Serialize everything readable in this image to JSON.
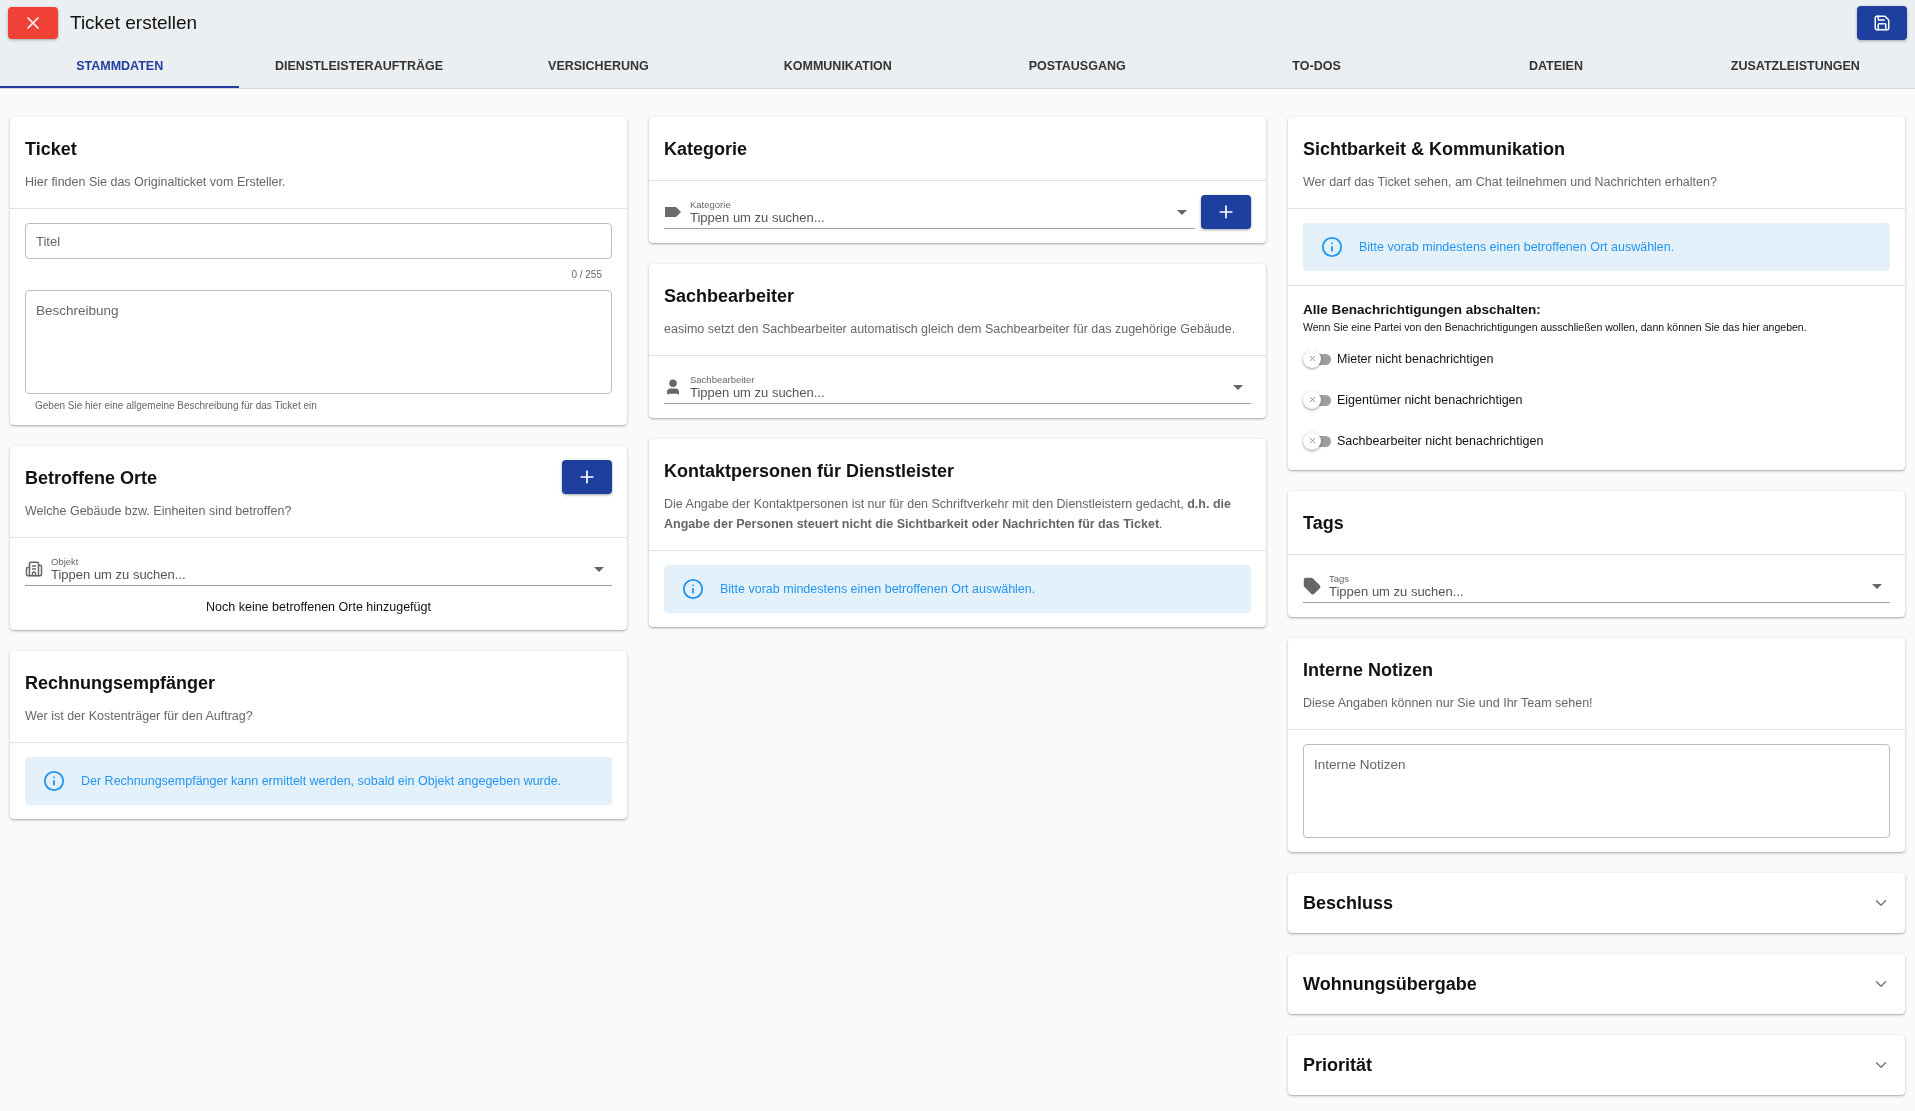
{
  "header": {
    "title": "Ticket erstellen"
  },
  "tabs": [
    {
      "label": "STAMMDATEN",
      "selected": true
    },
    {
      "label": "DIENSTLEISTERAUFTRÄGE",
      "selected": false
    },
    {
      "label": "VERSICHERUNG",
      "selected": false
    },
    {
      "label": "KOMMUNIKATION",
      "selected": false
    },
    {
      "label": "POSTAUSGANG",
      "selected": false
    },
    {
      "label": "TO-DOS",
      "selected": false
    },
    {
      "label": "DATEIEN",
      "selected": false
    },
    {
      "label": "ZUSATZLEISTUNGEN",
      "selected": false
    }
  ],
  "columns": [
    {
      "cards": [
        {
          "kind": "form",
          "title": "Ticket",
          "subtitle": "Hier finden Sie das Originalticket vom Ersteller.",
          "sections": [
            [
              {
                "kind": "text_field",
                "placeholder": "Titel",
                "counter": "0 / 255"
              },
              {
                "kind": "textarea",
                "placeholder": "Beschreibung",
                "helper": "Geben Sie hier eine allgemeine Beschreibung für das Ticket ein"
              }
            ]
          ]
        },
        {
          "kind": "form",
          "title": "Betroffene Orte",
          "subtitle": "Welche Gebäude bzw. Einheiten sind betroffen?",
          "add_button": true,
          "sections": [
            [
              {
                "kind": "select",
                "label": "Objekt",
                "placeholder": "Tippen um zu suchen..."
              },
              {
                "kind": "note",
                "text": "Noch keine betroffenen Orte hinzugefügt"
              }
            ]
          ]
        },
        {
          "kind": "form",
          "title": "Rechnungsempfänger",
          "subtitle": "Wer ist der Kostenträger für den Auftrag?",
          "sections": [
            [
              {
                "kind": "info",
                "text": "Der Rechnungsempfänger kann ermittelt werden, sobald ein Objekt angegeben wurde."
              }
            ]
          ]
        }
      ]
    },
    {
      "cards": [
        {
          "kind": "form",
          "title": "Kategorie",
          "sections": [
            [
              {
                "kind": "select",
                "label": "Kategorie",
                "placeholder": "Tippen um zu suchen...",
                "add_button": true
              }
            ]
          ]
        },
        {
          "kind": "form",
          "title": "Sachbearbeiter",
          "subtitle": "easimo setzt den Sachbearbeiter automatisch gleich dem Sachbearbeiter für das zugehörige Gebäude.",
          "sections": [
            [
              {
                "kind": "select",
                "label": "Sachbearbeiter",
                "placeholder": "Tippen um zu suchen..."
              }
            ]
          ]
        },
        {
          "kind": "form",
          "title": "Kontaktpersonen für Dienstleister",
          "subtitle": "Die Angabe der Kontaktpersonen ist nur für den Schriftverkehr mit den Dienstleistern gedacht, **d.h. die Angabe der Personen steuert nicht die Sichtbarkeit oder Nachrichten für das Ticket**.",
          "sections": [
            [
              {
                "kind": "info",
                "text": "Bitte vorab mindestens einen betroffenen Ort auswählen."
              }
            ]
          ]
        }
      ]
    },
    {
      "cards": [
        {
          "kind": "form",
          "title": "Sichtbarkeit & Kommunikation",
          "subtitle": "Wer darf das Ticket sehen, am Chat teilnehmen und Nachrichten erhalten?",
          "sections": [
            [
              {
                "kind": "info",
                "text": "Bitte vorab mindestens einen betroffenen Ort auswählen."
              }
            ],
            [
              {
                "kind": "toggles",
                "heading": "Alle Benachrichtigungen abschalten:",
                "text": "Wenn Sie eine Partei von den Benachrichtigungen ausschließen wollen, dann können Sie das hier angeben.",
                "items": [
                  {
                    "label": "Mieter nicht benachrichtigen",
                    "on": false
                  },
                  {
                    "label": "Eigentümer nicht benachrichtigen",
                    "on": false
                  },
                  {
                    "label": "Sachbearbeiter nicht benachrichtigen",
                    "on": false
                  }
                ]
              }
            ]
          ]
        },
        {
          "kind": "form",
          "title": "Tags",
          "sections": [
            [
              {
                "kind": "select",
                "label": "Tags",
                "placeholder": "Tippen um zu suchen..."
              }
            ]
          ]
        },
        {
          "kind": "form",
          "title": "Interne Notizen",
          "subtitle": "Diese Angaben können nur Sie und Ihr Team sehen!",
          "sections": [
            [
              {
                "kind": "textarea",
                "placeholder": "Interne Notizen"
              }
            ]
          ]
        },
        {
          "kind": "accordion",
          "title": "Beschluss",
          "expanded": false
        },
        {
          "kind": "accordion",
          "title": "Wohnungsübergabe",
          "expanded": false
        },
        {
          "kind": "accordion",
          "title": "Priorität",
          "expanded": false
        }
      ]
    }
  ]
}
